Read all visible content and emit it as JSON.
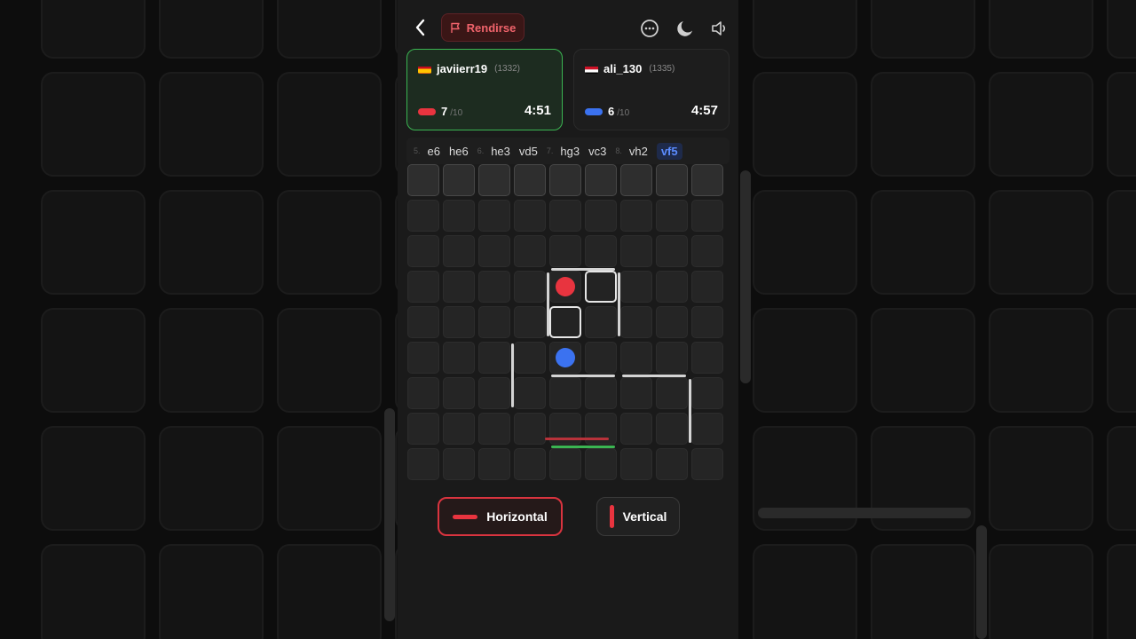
{
  "header": {
    "resign_label": "Rendirse",
    "icons": [
      "back-icon",
      "flag-icon",
      "chat-icon",
      "moon-icon",
      "speaker-icon"
    ]
  },
  "players": [
    {
      "name": "javiierr19",
      "rating": "(1332)",
      "walls_left": "7",
      "walls_total": "/10",
      "time": "4:51",
      "flag": "spain-flag",
      "color": "#e8343f",
      "active": true
    },
    {
      "name": "ali_130",
      "rating": "(1335)",
      "walls_left": "6",
      "walls_total": "/10",
      "time": "4:57",
      "flag": "egypt-flag",
      "color": "#3b72f0",
      "active": false
    }
  ],
  "move_history": [
    {
      "num": "5.",
      "moves": [
        "e6",
        "he6"
      ]
    },
    {
      "num": "6.",
      "moves": [
        "he3",
        "vd5"
      ]
    },
    {
      "num": "7.",
      "moves": [
        "hg3",
        "vc3"
      ]
    },
    {
      "num": "8.",
      "moves": [
        "vh2",
        "vf5"
      ]
    }
  ],
  "active_move": "vf5",
  "board": {
    "size": 9,
    "red_pawn": {
      "row": 3,
      "col": 4
    },
    "blue_pawn": {
      "row": 5,
      "col": 4
    },
    "highlighted_cells": [
      {
        "row": 3,
        "col": 5
      },
      {
        "row": 4,
        "col": 4
      }
    ],
    "colors": {
      "red": "#e8343f",
      "blue": "#3b72f0",
      "wall": "#d4d4d4",
      "ghost_red": "#b8323a",
      "ghost_green": "#3bb552"
    }
  },
  "orientation": {
    "horizontal_label": "Horizontal",
    "vertical_label": "Vertical",
    "selected": "Horizontal"
  }
}
